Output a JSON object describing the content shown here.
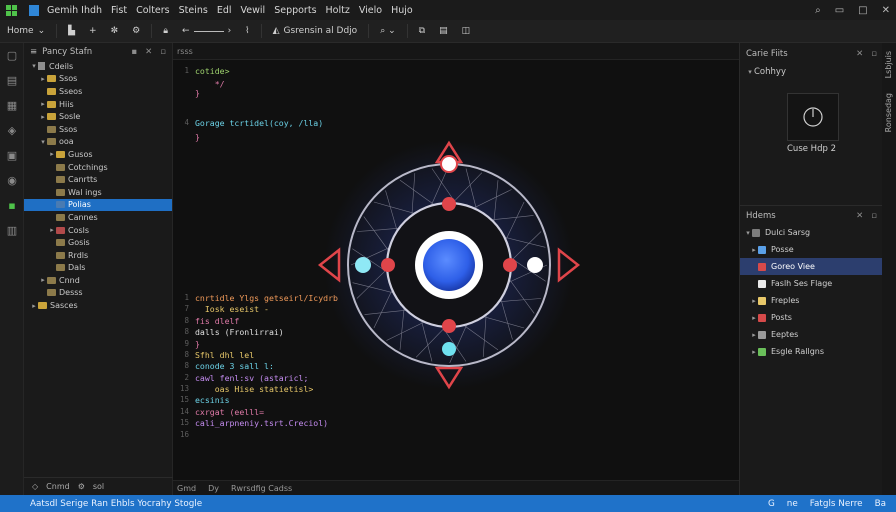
{
  "menubar": {
    "items": [
      "Gemih Ihdh",
      "Fist",
      "Colters",
      "Steins",
      "Edl",
      "Vewil",
      "Sepports",
      "Holtz",
      "Vielo",
      "Hujo"
    ],
    "right_icons": [
      "search-icon",
      "restore-icon",
      "maximize-icon",
      "close-icon"
    ]
  },
  "toolbar": {
    "home": "Home",
    "mid_label": "Gsrensin al Ddjo"
  },
  "explorer": {
    "title": "Pancy Stafn",
    "tree": [
      {
        "label": "Cdeils",
        "depth": 0,
        "chev": "▾",
        "kind": "file"
      },
      {
        "label": "Ssos",
        "depth": 1,
        "chev": "▸",
        "kind": "folder"
      },
      {
        "label": "Sseos",
        "depth": 1,
        "chev": "",
        "kind": "folder"
      },
      {
        "label": "Hiis",
        "depth": 1,
        "chev": "▸",
        "kind": "folder"
      },
      {
        "label": "Sosle",
        "depth": 1,
        "chev": "▸",
        "kind": "folder"
      },
      {
        "label": "Ssos",
        "depth": 1,
        "chev": "",
        "kind": "folder-muted"
      },
      {
        "label": "ooa",
        "depth": 1,
        "chev": "▾",
        "kind": "folder-muted"
      },
      {
        "label": "Gusos",
        "depth": 2,
        "chev": "▸",
        "kind": "folder"
      },
      {
        "label": "Cotchings",
        "depth": 2,
        "chev": "",
        "kind": "folder-muted"
      },
      {
        "label": "Canrtts",
        "depth": 2,
        "chev": "",
        "kind": "folder-muted"
      },
      {
        "label": "Wal ings",
        "depth": 2,
        "chev": "",
        "kind": "folder-muted"
      },
      {
        "label": "Polias",
        "depth": 2,
        "chev": "",
        "kind": "folder-blue",
        "selected": true
      },
      {
        "label": "Cannes",
        "depth": 2,
        "chev": "",
        "kind": "folder-muted"
      },
      {
        "label": "Cosls",
        "depth": 2,
        "chev": "▸",
        "kind": "folder-red"
      },
      {
        "label": "Gosis",
        "depth": 2,
        "chev": "",
        "kind": "folder-muted"
      },
      {
        "label": "Rrdls",
        "depth": 2,
        "chev": "",
        "kind": "folder-muted"
      },
      {
        "label": "Dals",
        "depth": 2,
        "chev": "",
        "kind": "folder-muted"
      },
      {
        "label": "Cnnd",
        "depth": 1,
        "chev": "▸",
        "kind": "folder-muted"
      },
      {
        "label": "Desss",
        "depth": 1,
        "chev": "",
        "kind": "folder-muted"
      },
      {
        "label": "Sasces",
        "depth": 0,
        "chev": "▸",
        "kind": "folder"
      }
    ],
    "footer": [
      "Cnmd",
      "sol"
    ]
  },
  "editor": {
    "tab_label": "rsss",
    "status": [
      "Gmd",
      "Dy",
      "Rwrsdfig Cadss"
    ],
    "code": [
      {
        "n": "1",
        "t": "cotide>",
        "c": "c-green",
        "i": 0
      },
      {
        "n": "",
        "t": "    */",
        "c": "c-pink",
        "i": 0
      },
      {
        "n": "",
        "t": "}",
        "c": "c-pink",
        "i": 0
      },
      {
        "n": "",
        "t": "",
        "c": "",
        "i": 0
      },
      {
        "n": "4",
        "t": "Gorage tcrtidel(coy, /lla)",
        "c": "c-cyan",
        "i": 0
      },
      {
        "n": "",
        "t": "}",
        "c": "c-pink",
        "i": 0
      },
      {
        "n": "1",
        "t": "cnrtidle Ylgs getseirl/Icydrb",
        "c": "c-orange",
        "i": 0
      },
      {
        "n": "7",
        "t": "  Iosk eseist -",
        "c": "c-yellow",
        "i": 0
      },
      {
        "n": "8",
        "t": "fis dlelf",
        "c": "c-pink",
        "i": 0
      },
      {
        "n": "8",
        "t": "dalls (Fronlirrai)",
        "c": "c-white",
        "i": 0
      },
      {
        "n": "9",
        "t": "}",
        "c": "c-pink",
        "i": 0
      },
      {
        "n": "8",
        "t": "Sfhl dhl lel",
        "c": "c-yellow",
        "i": 0
      },
      {
        "n": "8",
        "t": "conode 3 sall l:",
        "c": "c-cyan",
        "i": 0
      },
      {
        "n": "2",
        "t": "cawl fenl:sv (astaricl;",
        "c": "c-purple",
        "i": 0
      },
      {
        "n": "13",
        "t": "    oas Hise statietisl>",
        "c": "c-yellow",
        "i": 0
      },
      {
        "n": "15",
        "t": "ecsinis",
        "c": "c-cyan",
        "i": 0
      },
      {
        "n": "14",
        "t": "cxrgat (eelll=",
        "c": "c-pink",
        "i": 0
      },
      {
        "n": "15",
        "t": "cali_arpneniy.tsrt.Creciol)",
        "c": "c-purple",
        "i": 0
      },
      {
        "n": "16",
        "t": "",
        "c": "",
        "i": 0
      }
    ]
  },
  "right": {
    "output_title": "Carie Fiits",
    "output_sub": "Cohhyy",
    "preview_caption": "Cuse Hdp 2",
    "layers_title": "Hdems",
    "layers": [
      {
        "label": "Dulci Sarsg",
        "chev": "▾",
        "color": "#7c7c7c"
      },
      {
        "label": "Posse",
        "chev": "▸",
        "color": "#5aa0e8"
      },
      {
        "label": "Goreo Viee",
        "chev": "",
        "color": "#d64a4a",
        "selected": true
      },
      {
        "label": "Faslh Ses Flage",
        "chev": "",
        "color": "#eaeaea"
      },
      {
        "label": "Freples",
        "chev": "▸",
        "color": "#e8c86a"
      },
      {
        "label": "Posts",
        "chev": "▸",
        "color": "#d64a4a"
      },
      {
        "label": "Eeptes",
        "chev": "▸",
        "color": "#9a9a9a"
      },
      {
        "label": "Esgle Rallgns",
        "chev": "▸",
        "color": "#6abf5a"
      }
    ],
    "strip_labels": [
      "Lsbjuis",
      "Ronsedag"
    ]
  },
  "statusbar": {
    "left": "Aatsdl Serige Ran Ehbls Yocrahy Stogle",
    "right": [
      "G",
      "ne",
      "Fatgls Nerre",
      "Ba"
    ]
  },
  "colors": {
    "accent": "#1f72c9",
    "orb_core": "#2e5fe8",
    "node_red": "#e0454a",
    "node_cyan": "#6fe0f0"
  }
}
